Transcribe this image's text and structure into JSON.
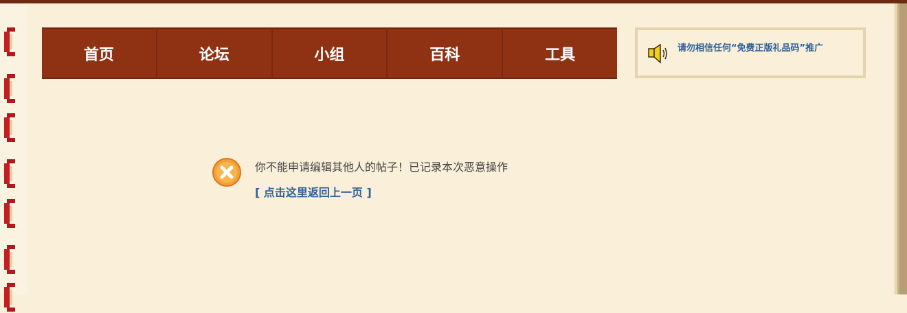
{
  "nav": {
    "items": [
      {
        "label": "首页"
      },
      {
        "label": "论坛"
      },
      {
        "label": "小组"
      },
      {
        "label": "百科"
      },
      {
        "label": "工具"
      }
    ]
  },
  "notice": {
    "icon": "speaker-icon",
    "text": "请勿相信任何“免费正版礼品码”推广"
  },
  "message": {
    "icon": "error-icon",
    "text": "你不能申请编辑其他人的帖子！已记录本次恶意操作",
    "back_link": "[ 点击这里返回上一页 ]"
  },
  "colors": {
    "nav_bg": "#8f3213",
    "page_bg": "#faf0d9",
    "link": "#2f5f9a",
    "ring": "#c21f22"
  }
}
